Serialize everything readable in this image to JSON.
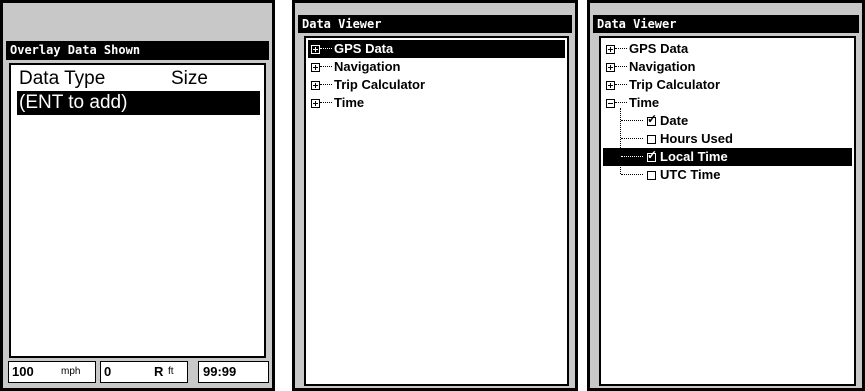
{
  "overlay": {
    "title": "Overlay Data Shown",
    "header_type": "Data Type",
    "header_size": "Size",
    "ent_row": "(ENT to add)",
    "status": {
      "speed": "100",
      "speed_unit": "mph",
      "depth": "0",
      "depth_flag": "R",
      "depth_unit": "ft",
      "time": "99:99"
    }
  },
  "viewer1": {
    "title": "Data Viewer",
    "items": [
      "GPS Data",
      "Navigation",
      "Trip Calculator",
      "Time"
    ]
  },
  "viewer2": {
    "title": "Data Viewer",
    "items": [
      "GPS Data",
      "Navigation",
      "Trip Calculator",
      "Time"
    ],
    "time_children": [
      "Date",
      "Hours Used",
      "Local Time",
      "UTC Time"
    ]
  }
}
